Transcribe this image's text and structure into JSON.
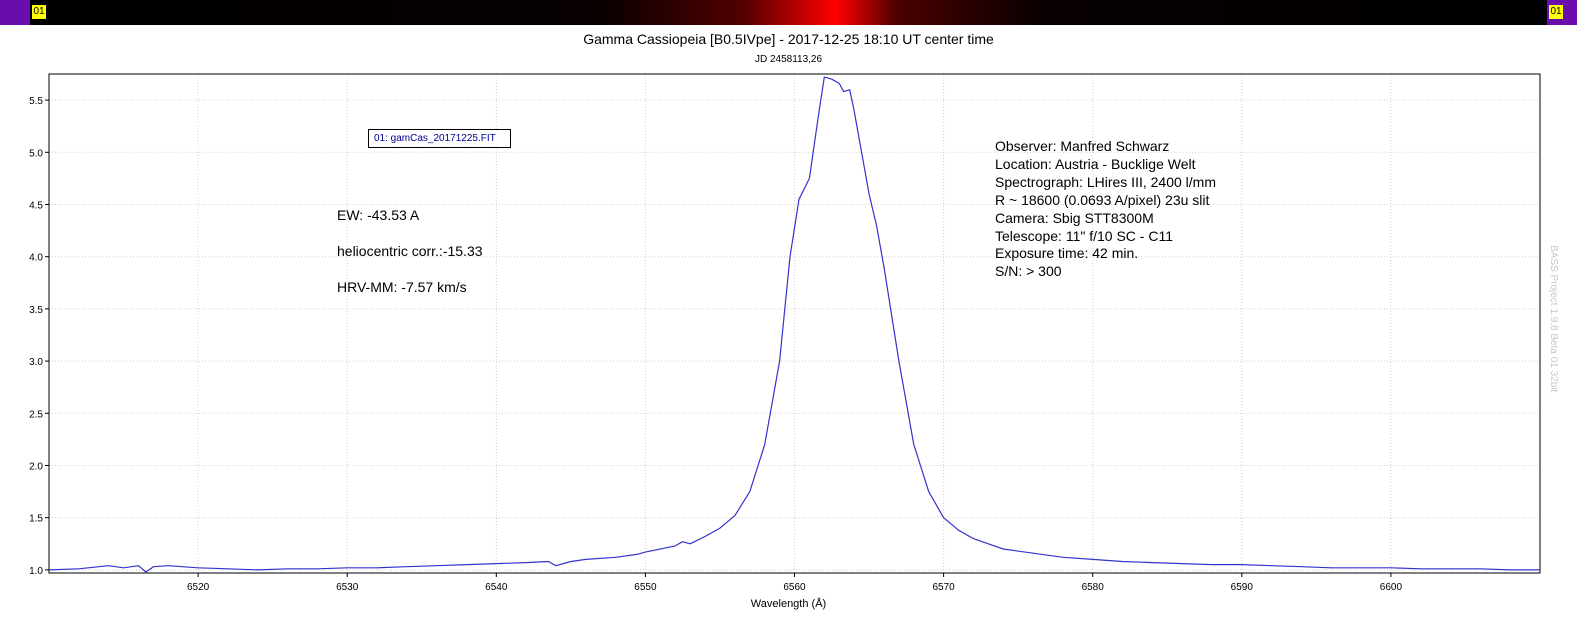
{
  "colorbar": {
    "left_label": "01",
    "right_label": "01",
    "background": "#000000",
    "peak_color": "#ff0000",
    "edge_color": "#6a0dad",
    "label_bg": "#ffff00"
  },
  "chart_data": {
    "type": "line",
    "title": "Gamma Cassiopeia [B0.5IVpe] - 2017-12-25 18:10 UT center time",
    "subtitle": "JD 2458113,26",
    "xlabel": "Wavelength (Å)",
    "ylabel": "",
    "xlim": [
      6510,
      6610
    ],
    "ylim": [
      0.97,
      5.75
    ],
    "grid": true,
    "line_color": "#3333cc",
    "x_ticks": [
      "6520",
      "6530",
      "6540",
      "6550",
      "6560",
      "6570",
      "6580",
      "6590",
      "6600"
    ],
    "y_ticks": [
      "1.0",
      "1.5",
      "2.0",
      "2.5",
      "3.0",
      "3.5",
      "4.0",
      "4.5",
      "5.0",
      "5.5"
    ],
    "series": [
      {
        "name": "01: gamCas_20171225.FIT",
        "x": [
          6510,
          6512,
          6514,
          6515,
          6516,
          6516.5,
          6517,
          6518,
          6520,
          6522,
          6524,
          6526,
          6528,
          6530,
          6532,
          6534,
          6536,
          6538,
          6540,
          6542,
          6543.5,
          6544,
          6545,
          6546,
          6548,
          6549.5,
          6550,
          6552,
          6552.5,
          6553,
          6554,
          6555,
          6556,
          6557,
          6558,
          6559,
          6559.7,
          6560.3,
          6561,
          6561.6,
          6562,
          6562.5,
          6563,
          6563.3,
          6563.7,
          6564,
          6564.5,
          6565,
          6565.5,
          6566,
          6567,
          6568,
          6569,
          6570,
          6571,
          6572,
          6573,
          6574,
          6576,
          6578,
          6580,
          6582,
          6584,
          6586,
          6588,
          6590,
          6592,
          6594,
          6596,
          6598,
          6600,
          6602,
          6604,
          6606,
          6608,
          6610
        ],
        "y": [
          1.0,
          1.01,
          1.04,
          1.02,
          1.04,
          0.98,
          1.03,
          1.04,
          1.02,
          1.01,
          1.0,
          1.01,
          1.01,
          1.02,
          1.02,
          1.03,
          1.04,
          1.05,
          1.06,
          1.07,
          1.08,
          1.04,
          1.08,
          1.1,
          1.12,
          1.15,
          1.17,
          1.23,
          1.27,
          1.25,
          1.32,
          1.4,
          1.52,
          1.75,
          2.2,
          3.0,
          4.0,
          4.55,
          4.75,
          5.35,
          5.72,
          5.7,
          5.66,
          5.58,
          5.6,
          5.4,
          5.0,
          4.6,
          4.3,
          3.9,
          3.0,
          2.2,
          1.75,
          1.5,
          1.38,
          1.3,
          1.25,
          1.2,
          1.16,
          1.12,
          1.1,
          1.08,
          1.07,
          1.06,
          1.05,
          1.05,
          1.04,
          1.03,
          1.02,
          1.02,
          1.02,
          1.01,
          1.01,
          1.01,
          1.0,
          1.0
        ]
      }
    ]
  },
  "legend_text": "01: gamCas_20171225.FIT",
  "measurements": {
    "ew": "EW: -43.53 A",
    "helio": "heliocentric corr.:-15.33",
    "hrv": "HRV-MM: -7.57 km/s"
  },
  "observer_info": [
    "Observer: Manfred Schwarz",
    "Location: Austria - Bucklige Welt",
    "Spectrograph: LHires III, 2400 l/mm",
    "R ~ 18600 (0.0693 A/pixel) 23u slit",
    "Camera: Sbig STT8300M",
    "Telescope: 11\" f/10 SC - C11",
    "Exposure time: 42 min.",
    "S/N:  > 300"
  ],
  "watermark": "BASS Project 1.9.8 Beta 01 32bit"
}
